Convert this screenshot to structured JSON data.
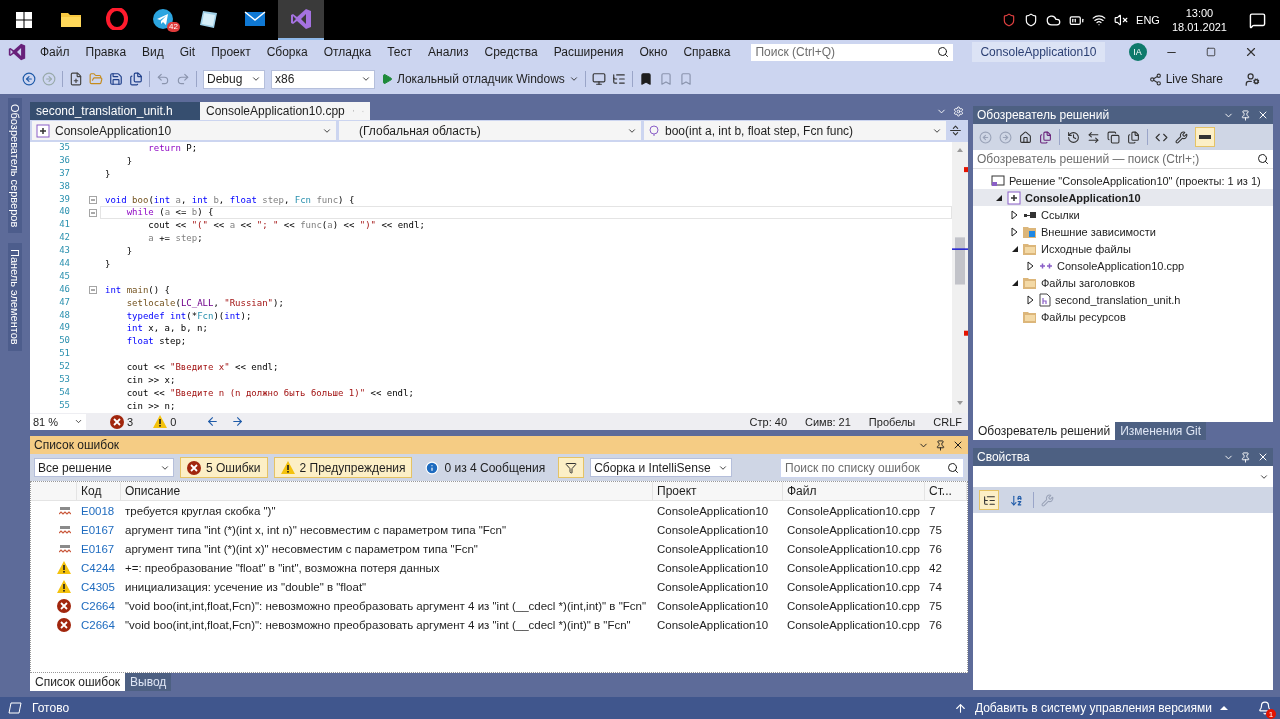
{
  "taskbar": {
    "apps": [
      {
        "kind": "explorer",
        "selected": false
      },
      {
        "kind": "opera",
        "selected": false
      },
      {
        "kind": "telegram",
        "selected": false,
        "badge": "42"
      },
      {
        "kind": "notes",
        "selected": false
      },
      {
        "kind": "mail",
        "selected": false
      },
      {
        "kind": "vs",
        "selected": true
      }
    ],
    "language": "ENG",
    "time": "13:00",
    "date": "18.01.2021"
  },
  "menu": {
    "items": [
      "Файл",
      "Правка",
      "Вид",
      "Git",
      "Проект",
      "Сборка",
      "Отладка",
      "Тест",
      "Анализ",
      "Средства",
      "Расширения",
      "Окно",
      "Справка"
    ],
    "search_placeholder": "Поиск (Ctrl+Q)",
    "solution_name": "ConsoleApplication10",
    "avatar": "IA"
  },
  "toolbar": {
    "configuration": "Debug",
    "platform": "x86",
    "debugger": "Локальный отладчик Windows",
    "live_share": "Live Share"
  },
  "side_tabs": [
    "Обозреватель серверов",
    "Панель элементов"
  ],
  "editor": {
    "tabs": [
      {
        "label": "second_translation_unit.h",
        "selected": false
      },
      {
        "label": "ConsoleApplication10.cpp",
        "selected": true
      }
    ],
    "nav": {
      "project": "ConsoleApplication10",
      "scope": "(Глобальная область)",
      "member": "boo(int a, int b, float step, Fcn func)"
    },
    "lines": [
      {
        "number": "35",
        "foldable": false,
        "current": false,
        "tokens": [
          {
            "kind": "control",
            "text": "        return"
          },
          {
            "kind": "plain",
            "text": " P;"
          }
        ]
      },
      {
        "number": "36",
        "foldable": false,
        "current": false,
        "tokens": [
          {
            "kind": "plain",
            "text": "    }"
          }
        ]
      },
      {
        "number": "37",
        "foldable": false,
        "current": false,
        "tokens": [
          {
            "kind": "plain",
            "text": "}"
          }
        ]
      },
      {
        "number": "38",
        "foldable": false,
        "current": false
      },
      {
        "number": "39",
        "foldable": true,
        "current": false,
        "tokens": [
          {
            "kind": "keyword",
            "text": "void"
          },
          {
            "kind": "func",
            "text": " boo"
          },
          {
            "kind": "plain",
            "text": "("
          },
          {
            "kind": "keyword",
            "text": "int"
          },
          {
            "kind": "param",
            "text": " a"
          },
          {
            "kind": "plain",
            "text": ", "
          },
          {
            "kind": "keyword",
            "text": "int"
          },
          {
            "kind": "param",
            "text": " b"
          },
          {
            "kind": "plain",
            "text": ", "
          },
          {
            "kind": "keyword",
            "text": "float"
          },
          {
            "kind": "param",
            "text": " step"
          },
          {
            "kind": "plain",
            "text": ", "
          },
          {
            "kind": "type",
            "text": "Fcn"
          },
          {
            "kind": "param",
            "text": " func"
          },
          {
            "kind": "plain",
            "text": ") {"
          }
        ]
      },
      {
        "number": "40",
        "foldable": true,
        "current": true,
        "tokens": [
          {
            "kind": "control",
            "text": "    while"
          },
          {
            "kind": "plain",
            "text": " ("
          },
          {
            "kind": "param",
            "text": "a"
          },
          {
            "kind": "plain",
            "text": " <= "
          },
          {
            "kind": "param",
            "text": "b"
          },
          {
            "kind": "plain",
            "text": ") {"
          }
        ]
      },
      {
        "number": "41",
        "foldable": false,
        "current": false,
        "tokens": [
          {
            "kind": "plain",
            "text": "        cout << "
          },
          {
            "kind": "string",
            "text": "\"(\""
          },
          {
            "kind": "plain",
            "text": " << "
          },
          {
            "kind": "param",
            "text": "a"
          },
          {
            "kind": "plain",
            "text": " << "
          },
          {
            "kind": "string",
            "text": "\"; \""
          },
          {
            "kind": "plain",
            "text": " << "
          },
          {
            "kind": "param",
            "text": "func"
          },
          {
            "kind": "plain",
            "text": "("
          },
          {
            "kind": "param",
            "text": "a"
          },
          {
            "kind": "plain",
            "text": ") << "
          },
          {
            "kind": "string",
            "text": "\")\""
          },
          {
            "kind": "plain",
            "text": " << endl;"
          }
        ]
      },
      {
        "number": "42",
        "foldable": false,
        "current": false,
        "tokens": [
          {
            "kind": "param",
            "text": "        a"
          },
          {
            "kind": "plain",
            "text": " += "
          },
          {
            "kind": "param",
            "text": "step"
          },
          {
            "kind": "plain",
            "text": ";"
          }
        ]
      },
      {
        "number": "43",
        "foldable": false,
        "current": false,
        "tokens": [
          {
            "kind": "plain",
            "text": "    }"
          }
        ]
      },
      {
        "number": "44",
        "foldable": false,
        "current": false,
        "tokens": [
          {
            "kind": "plain",
            "text": "}"
          }
        ]
      },
      {
        "number": "45",
        "foldable": false,
        "current": false
      },
      {
        "number": "46",
        "foldable": true,
        "current": false,
        "tokens": [
          {
            "kind": "keyword",
            "text": "int"
          },
          {
            "kind": "func",
            "text": " main"
          },
          {
            "kind": "plain",
            "text": "() {"
          }
        ]
      },
      {
        "number": "47",
        "foldable": false,
        "current": false,
        "tokens": [
          {
            "kind": "func",
            "text": "    setlocale"
          },
          {
            "kind": "plain",
            "text": "("
          },
          {
            "kind": "macro",
            "text": "LC_ALL"
          },
          {
            "kind": "plain",
            "text": ", "
          },
          {
            "kind": "string",
            "text": "\"Russian\""
          },
          {
            "kind": "plain",
            "text": ");"
          }
        ]
      },
      {
        "number": "48",
        "foldable": false,
        "current": false,
        "tokens": [
          {
            "kind": "keyword",
            "text": "    typedef"
          },
          {
            "kind": "keyword",
            "text": " int"
          },
          {
            "kind": "plain",
            "text": "(*"
          },
          {
            "kind": "type",
            "text": "Fcn"
          },
          {
            "kind": "plain",
            "text": ")("
          },
          {
            "kind": "keyword",
            "text": "int"
          },
          {
            "kind": "plain",
            "text": ");"
          }
        ]
      },
      {
        "number": "49",
        "foldable": false,
        "current": false,
        "tokens": [
          {
            "kind": "keyword",
            "text": "    int"
          },
          {
            "kind": "plain",
            "text": " x, a, b, n;"
          }
        ]
      },
      {
        "number": "50",
        "foldable": false,
        "current": false,
        "tokens": [
          {
            "kind": "keyword",
            "text": "    float"
          },
          {
            "kind": "plain",
            "text": " step;"
          }
        ]
      },
      {
        "number": "51",
        "foldable": false,
        "current": false
      },
      {
        "number": "52",
        "foldable": false,
        "current": false,
        "tokens": [
          {
            "kind": "plain",
            "text": "    cout << "
          },
          {
            "kind": "string",
            "text": "\"Введите x\""
          },
          {
            "kind": "plain",
            "text": " << endl;"
          }
        ]
      },
      {
        "number": "53",
        "foldable": false,
        "current": false,
        "tokens": [
          {
            "kind": "plain",
            "text": "    cin >> x;"
          }
        ]
      },
      {
        "number": "54",
        "foldable": false,
        "current": false,
        "tokens": [
          {
            "kind": "plain",
            "text": "    cout << "
          },
          {
            "kind": "string",
            "text": "\"Введите n (n должно быть больше 1)\""
          },
          {
            "kind": "plain",
            "text": " << endl;"
          }
        ]
      },
      {
        "number": "55",
        "foldable": false,
        "current": false,
        "tokens": [
          {
            "kind": "plain",
            "text": "    cin >> n;"
          }
        ]
      }
    ],
    "status": {
      "zoom": "81 %",
      "errors": "3",
      "warnings": "0",
      "line": "Стр: 40",
      "column": "Симв: 21",
      "indent": "Пробелы",
      "eol": "CRLF"
    }
  },
  "error_list": {
    "title": "Список ошибок",
    "scope": "Все решение",
    "filters": [
      {
        "kind": "error",
        "label": "5 Ошибки",
        "selected": true
      },
      {
        "kind": "warning",
        "label": "2 Предупреждения",
        "selected": true
      },
      {
        "kind": "info",
        "label": "0 из 4 Сообщения",
        "selected": false
      }
    ],
    "source": "Сборка и IntelliSense",
    "search_placeholder": "Поиск по списку ошибок",
    "columns": [
      "Код",
      "Описание",
      "Проект",
      "Файл",
      "Ст..."
    ],
    "rows": [
      {
        "kind": "intellisense",
        "code": "E0018",
        "description": "требуется круглая скобка \")\"",
        "project": "ConsoleApplication10",
        "file": "ConsoleApplication10.cpp",
        "line": "7"
      },
      {
        "kind": "intellisense",
        "code": "E0167",
        "description": "аргумент типа \"int (*)(int x, int n)\" несовместим с параметром типа \"Fcn\"",
        "project": "ConsoleApplication10",
        "file": "ConsoleApplication10.cpp",
        "line": "75"
      },
      {
        "kind": "intellisense",
        "code": "E0167",
        "description": "аргумент типа \"int (*)(int x)\" несовместим с параметром типа \"Fcn\"",
        "project": "ConsoleApplication10",
        "file": "ConsoleApplication10.cpp",
        "line": "76"
      },
      {
        "kind": "warning",
        "code": "C4244",
        "description": "+=: преобразование \"float\" в \"int\", возможна потеря данных",
        "project": "ConsoleApplication10",
        "file": "ConsoleApplication10.cpp",
        "line": "42"
      },
      {
        "kind": "warning",
        "code": "C4305",
        "description": "инициализация: усечение из \"double\" в \"float\"",
        "project": "ConsoleApplication10",
        "file": "ConsoleApplication10.cpp",
        "line": "74"
      },
      {
        "kind": "error",
        "code": "C2664",
        "description": "\"void boo(int,int,float,Fcn)\": невозможно преобразовать аргумент 4 из \"int (__cdecl *)(int,int)\" в \"Fcn\"",
        "project": "ConsoleApplication10",
        "file": "ConsoleApplication10.cpp",
        "line": "75"
      },
      {
        "kind": "error",
        "code": "C2664",
        "description": "\"void boo(int,int,float,Fcn)\": невозможно преобразовать аргумент 4 из \"int (__cdecl *)(int)\" в \"Fcn\"",
        "project": "ConsoleApplication10",
        "file": "ConsoleApplication10.cpp",
        "line": "76"
      }
    ],
    "tabs": [
      {
        "label": "Список ошибок",
        "selected": true
      },
      {
        "label": "Вывод",
        "selected": false
      }
    ]
  },
  "solution_explorer": {
    "title": "Обозреватель решений",
    "search_placeholder": "Обозреватель решений — поиск (Ctrl+;)",
    "tree": [
      {
        "kind": "solution",
        "label": "Решение \"ConsoleApplication10\" (проекты: 1 из 1)",
        "selected": false,
        "children": [
          {
            "kind": "project",
            "label": "ConsoleApplication10",
            "expanded": true,
            "selected": true,
            "children": [
              {
                "kind": "references",
                "label": "Ссылки",
                "expanded": false,
                "selected": false
              },
              {
                "kind": "external",
                "label": "Внешние зависимости",
                "expanded": false,
                "selected": false
              },
              {
                "kind": "folder",
                "label": "Исходные файлы",
                "expanded": true,
                "selected": false,
                "children": [
                  {
                    "kind": "cpp",
                    "label": "ConsoleApplication10.cpp",
                    "expanded": false,
                    "selected": false
                  }
                ]
              },
              {
                "kind": "folder",
                "label": "Файлы заголовков",
                "expanded": true,
                "selected": false,
                "children": [
                  {
                    "kind": "header",
                    "label": "second_translation_unit.h",
                    "expanded": false,
                    "selected": false
                  }
                ]
              },
              {
                "kind": "folder",
                "label": "Файлы ресурсов",
                "selected": false
              }
            ]
          }
        ]
      }
    ],
    "tabs": [
      {
        "label": "Обозреватель решений",
        "selected": true
      },
      {
        "label": "Изменения Git",
        "selected": false
      }
    ]
  },
  "properties": {
    "title": "Свойства"
  },
  "status_bar": {
    "text": "Готово",
    "source_control": "Добавить в систему управления версиями",
    "notifications": "1"
  }
}
